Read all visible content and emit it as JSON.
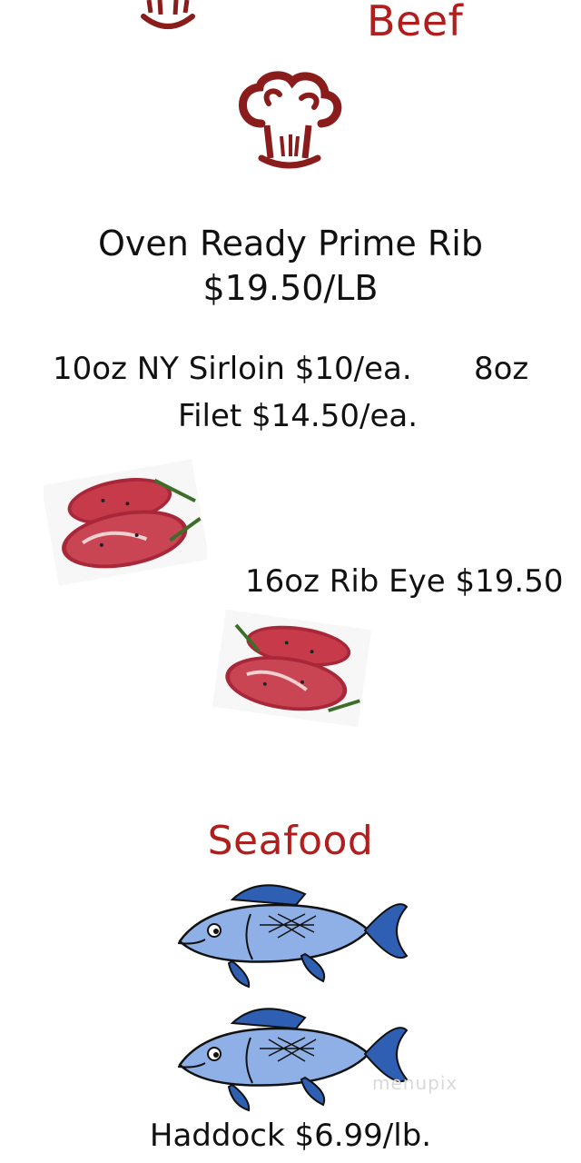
{
  "beef": {
    "title": "Beef",
    "prime_rib_line1": "Oven Ready Prime Rib",
    "prime_rib_line2": "$19.50/LB",
    "sirloin": "10oz NY Sirloin $10/ea.",
    "filet_size": "8oz",
    "filet_rest": "Filet $14.50/ea.",
    "ribeye": "16oz Rib Eye $19.50"
  },
  "seafood": {
    "title": "Seafood",
    "haddock": "Haddock $6.99/lb."
  },
  "watermark": "menupix",
  "colors": {
    "accent": "#b01e1e",
    "chef_hat": "#8a1c1c",
    "fish_body": "#8fb0e6",
    "fish_fin": "#2f5fb3"
  },
  "icons": [
    "chef-hat-icon",
    "steak-image",
    "fish-icon"
  ]
}
